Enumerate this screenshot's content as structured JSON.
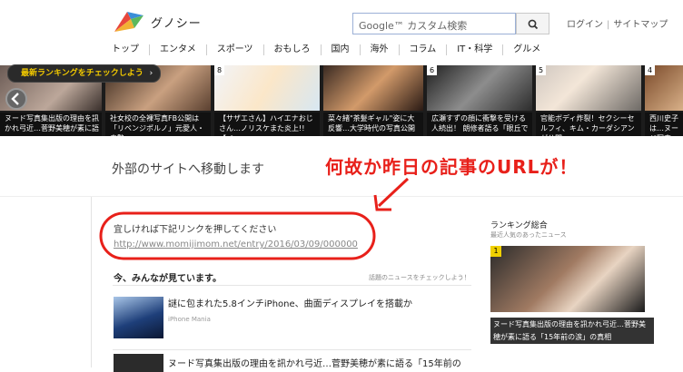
{
  "header": {
    "brand": "グノシー",
    "search_placeholder": "Google™ カスタム検索",
    "links": [
      "ログイン",
      "サイトマップ"
    ]
  },
  "nav": [
    "トップ",
    "エンタメ",
    "スポーツ",
    "おもしろ",
    "国内",
    "海外",
    "コラム",
    "IT・科学",
    "グルメ"
  ],
  "carousel": {
    "badge": "最新ランキングをチェックしよう",
    "cards": [
      {
        "num": "",
        "caption": "ヌード写真集出版の理由を訊かれ弓近…菅野美穂が素に語"
      },
      {
        "num": "",
        "caption": "社女校の全裸写真FB公開は「リベンジポルノ」元愛人・奏艶"
      },
      {
        "num": "8",
        "caption": "【サザエさん】ハイエナおじさん…ノリスケまた炎上!!【ペ"
      },
      {
        "num": "",
        "caption": "菜々緒\"茶髪ギャル\"姿に大反響…大学時代の写真公開"
      },
      {
        "num": "6",
        "caption": "広瀬すずの顔に衝撃を受ける人続出！ 朗修者語る「眼丘で"
      },
      {
        "num": "5",
        "caption": "官能ボディ炸裂！セクシーセルフィ、キム・カーダシアンが公開…"
      },
      {
        "num": "4",
        "caption": "西川史子は…ヌード写真"
      }
    ]
  },
  "main": {
    "leaving_title": "外部のサイトへ移動します",
    "overlay_note": "何故か昨日の記事のURLが！",
    "please": "宜しければ下記リンクを押してください",
    "link": "http://www.momijimom.net/entry/2016/03/09/000000",
    "watching_title": "今、みんなが見ています。",
    "watching_more": "話題のニュースをチェックしよう！",
    "articles": [
      {
        "title": "謎に包まれた5.8インチiPhone、曲面ディスプレイを搭載か",
        "source": "iPhone Mania"
      },
      {
        "title": "ヌード写真集出版の理由を訊かれ弓近…菅野美穂が素に語る「15年前の",
        "source": ""
      }
    ]
  },
  "sidebar": {
    "title": "ランキング総合",
    "subtitle": "最近人気のあったニュース",
    "num": "1",
    "caption1": "ヌード写真集出版の理由を訊かれ弓近…菅野美",
    "caption2": "穂が素に語る「15年前の涙」の真相"
  }
}
